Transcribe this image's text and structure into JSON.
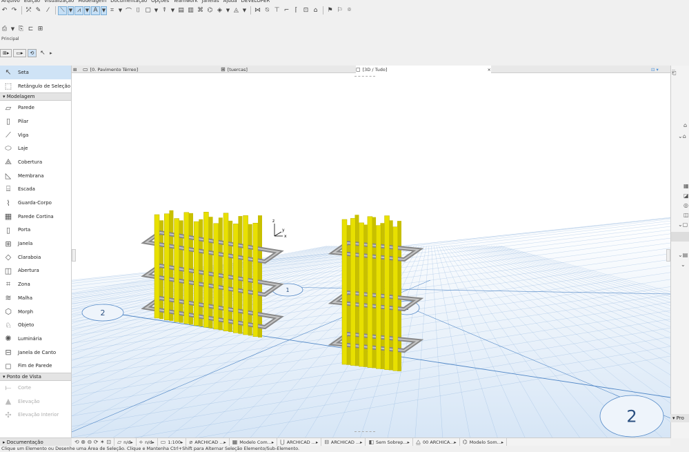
{
  "menu": [
    "Arquivo",
    "Edição",
    "Visualização",
    "Modelagem",
    "Documentação",
    "Opções",
    "Teamwork",
    "Janelas",
    "Ajuda",
    "DEVELOPER"
  ],
  "toolbar": {
    "section_label": "Principal"
  },
  "toolbox": {
    "top_tools": [
      {
        "label": "Seta",
        "icon": "arrow-cursor-icon",
        "glyph": "↖",
        "selected": true
      },
      {
        "label": "Retângulo de Seleção",
        "icon": "marquee-icon",
        "glyph": "⬚",
        "selected": false
      }
    ],
    "modelagem_label": "Modelagem",
    "modelagem": [
      {
        "label": "Parede",
        "icon": "wall-icon",
        "glyph": "▱"
      },
      {
        "label": "Pilar",
        "icon": "column-icon",
        "glyph": "▯"
      },
      {
        "label": "Viga",
        "icon": "beam-icon",
        "glyph": "⟋"
      },
      {
        "label": "Laje",
        "icon": "slab-icon",
        "glyph": "⬭"
      },
      {
        "label": "Cobertura",
        "icon": "roof-icon",
        "glyph": "⟁"
      },
      {
        "label": "Membrana",
        "icon": "shell-icon",
        "glyph": "◺"
      },
      {
        "label": "Escada",
        "icon": "stair-icon",
        "glyph": "⌸"
      },
      {
        "label": "Guarda-Corpo",
        "icon": "railing-icon",
        "glyph": "⌇"
      },
      {
        "label": "Parede Cortina",
        "icon": "curtain-wall-icon",
        "glyph": "▦"
      },
      {
        "label": "Porta",
        "icon": "door-icon",
        "glyph": "▯"
      },
      {
        "label": "Janela",
        "icon": "window-icon",
        "glyph": "⊞"
      },
      {
        "label": "Claraboia",
        "icon": "skylight-icon",
        "glyph": "◇"
      },
      {
        "label": "Abertura",
        "icon": "opening-icon",
        "glyph": "◫"
      },
      {
        "label": "Zona",
        "icon": "zone-icon",
        "glyph": "⌗"
      },
      {
        "label": "Malha",
        "icon": "mesh-icon",
        "glyph": "≋"
      },
      {
        "label": "Morph",
        "icon": "morph-icon",
        "glyph": "⬡"
      },
      {
        "label": "Objeto",
        "icon": "object-icon",
        "glyph": "♘"
      },
      {
        "label": "Luminária",
        "icon": "lamp-icon",
        "glyph": "✺"
      },
      {
        "label": "Janela de Canto",
        "icon": "corner-window-icon",
        "glyph": "⊟"
      },
      {
        "label": "Fim de Parede",
        "icon": "wall-end-icon",
        "glyph": "◻"
      }
    ],
    "ponto_label": "Ponto de Vista",
    "ponto": [
      {
        "label": "Corte",
        "icon": "section-icon",
        "glyph": "⟝"
      },
      {
        "label": "Elevação",
        "icon": "elevation-icon",
        "glyph": "▲"
      },
      {
        "label": "Elevação Interior",
        "icon": "interior-elevation-icon",
        "glyph": "✣"
      }
    ],
    "documentacao_label": "Documentação"
  },
  "tabs": [
    {
      "label": "[0. Pavimento Térreo]",
      "icon": "floor-plan-icon"
    },
    {
      "label": "[tuercas]",
      "icon": "schedule-icon"
    },
    {
      "label": "[3D / Tudo]",
      "icon": "3d-view-icon",
      "active": true
    }
  ],
  "tab_close": "×",
  "grid_bubbles": [
    "1",
    "2",
    "2",
    "2"
  ],
  "axis": {
    "x": "x",
    "y": "y",
    "z": "z"
  },
  "quickbar": [
    {
      "label": "n/d",
      "icon": "layer-icon"
    },
    {
      "label": "n/d",
      "icon": "pen-icon"
    },
    {
      "label": "1:100",
      "icon": "scale-icon"
    },
    {
      "label": "ARCHICAD ...",
      "icon": "layer-combo-icon"
    },
    {
      "label": "Modelo Com...",
      "icon": "model-view-icon"
    },
    {
      "label": "ARCHICAD ...",
      "icon": "pen-set-icon"
    },
    {
      "label": "ARCHICAD ...",
      "icon": "dimension-icon"
    },
    {
      "label": "Sem Sobrep...",
      "icon": "override-icon"
    },
    {
      "label": "00 ARCHICA...",
      "icon": "renovation-icon"
    },
    {
      "label": "Modelo Som...",
      "icon": "structure-icon"
    }
  ],
  "status": "Clique um Elemento ou Desenhe uma Área de Seleção. Clique e Mantenha Ctrl+Shift para Alternar Seleção Elemento/Sub-Elemento.",
  "right_panel_label": "Pro",
  "colors": {
    "rebar": "#e8e000",
    "steel": "#9a9a9a",
    "grid": "#7da8d8",
    "selection": "#cfe3f6"
  }
}
